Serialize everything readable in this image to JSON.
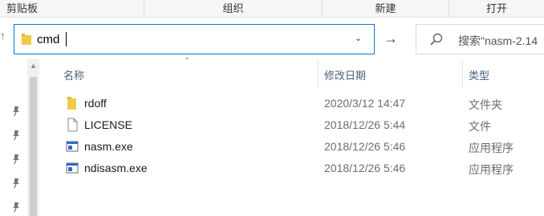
{
  "ribbon": {
    "groups": [
      "剪贴板",
      "组织",
      "新建",
      "打开"
    ]
  },
  "address_bar": {
    "value": "cmd",
    "icon": "folder-icon",
    "dropdown_icon": "chevron-down-icon",
    "go_icon": "arrow-right-icon"
  },
  "search": {
    "placeholder": "搜索\"nasm-2.14",
    "icon": "search-icon"
  },
  "columns": {
    "name": "名称",
    "modified": "修改日期",
    "type": "类型"
  },
  "files": [
    {
      "name": "rdoff",
      "modified": "2020/3/12 14:47",
      "type": "文件夹",
      "icon": "folder-icon"
    },
    {
      "name": "LICENSE",
      "modified": "2018/12/26 5:44",
      "type": "文件",
      "icon": "file-icon"
    },
    {
      "name": "nasm.exe",
      "modified": "2018/12/26 5:46",
      "type": "应用程序",
      "icon": "exe-icon"
    },
    {
      "name": "ndisasm.exe",
      "modified": "2018/12/26 5:46",
      "type": "应用程序",
      "icon": "exe-icon"
    }
  ],
  "colors": {
    "address_border": "#0078d7",
    "folder_yellow": "#f3c94a",
    "header_text": "#4c607a"
  }
}
